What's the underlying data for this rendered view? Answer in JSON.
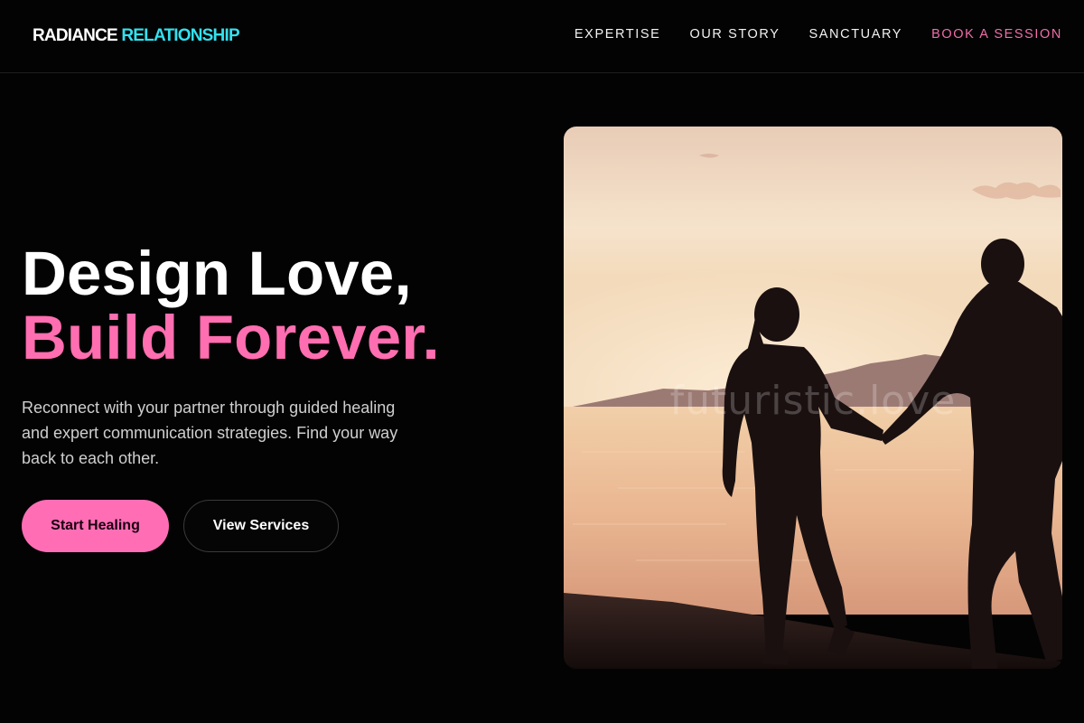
{
  "header": {
    "logo_part1": "RADIANCE",
    "logo_part2": "RELATIONSHIP",
    "nav": [
      {
        "label": "EXPERTISE"
      },
      {
        "label": "OUR STORY"
      },
      {
        "label": "SANCTUARY"
      },
      {
        "label": "BOOK A SESSION"
      }
    ]
  },
  "hero": {
    "title_line1": "Design Love,",
    "title_line2": "Build Forever.",
    "description": "Reconnect with your partner through guided healing and expert communication strategies. Find your way back to each other.",
    "primary_button": "Start Healing",
    "secondary_button": "View Services",
    "image_watermark": "futuristic.love"
  },
  "colors": {
    "background": "#030303",
    "brand_cyan": "#34e0ee",
    "accent_pink": "#ff6eb5"
  }
}
